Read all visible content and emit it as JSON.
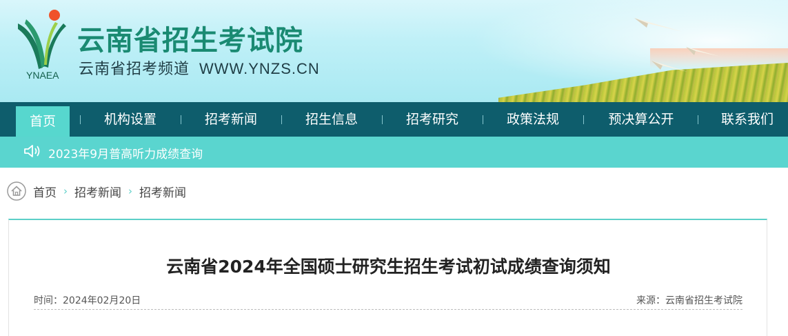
{
  "header": {
    "site_title": "云南省招生考试院",
    "subtitle": "云南省招考频道",
    "url": "WWW.YNZS.CN",
    "logo_abbr": "YNAEA"
  },
  "nav": {
    "items": [
      {
        "label": "首页",
        "active": true
      },
      {
        "label": "机构设置"
      },
      {
        "label": "招考新闻"
      },
      {
        "label": "招生信息"
      },
      {
        "label": "招考研究"
      },
      {
        "label": "政策法规"
      },
      {
        "label": "预决算公开"
      },
      {
        "label": "联系我们"
      }
    ]
  },
  "notice": {
    "icon": "speaker-icon",
    "text": "2023年9月普高听力成绩查询"
  },
  "breadcrumb": {
    "icon": "home-icon",
    "items": [
      "首页",
      "招考新闻",
      "招考新闻"
    ],
    "separator": "›"
  },
  "article": {
    "title": "云南省2024年全国硕士研究生招生考试初试成绩查询须知",
    "time": "时间：2024年02月20日",
    "source": "来源：云南省招生考试院"
  },
  "colors": {
    "nav_bg": "#0e5d6c",
    "accent": "#57d7ce",
    "title_green": "#1a8a72"
  }
}
